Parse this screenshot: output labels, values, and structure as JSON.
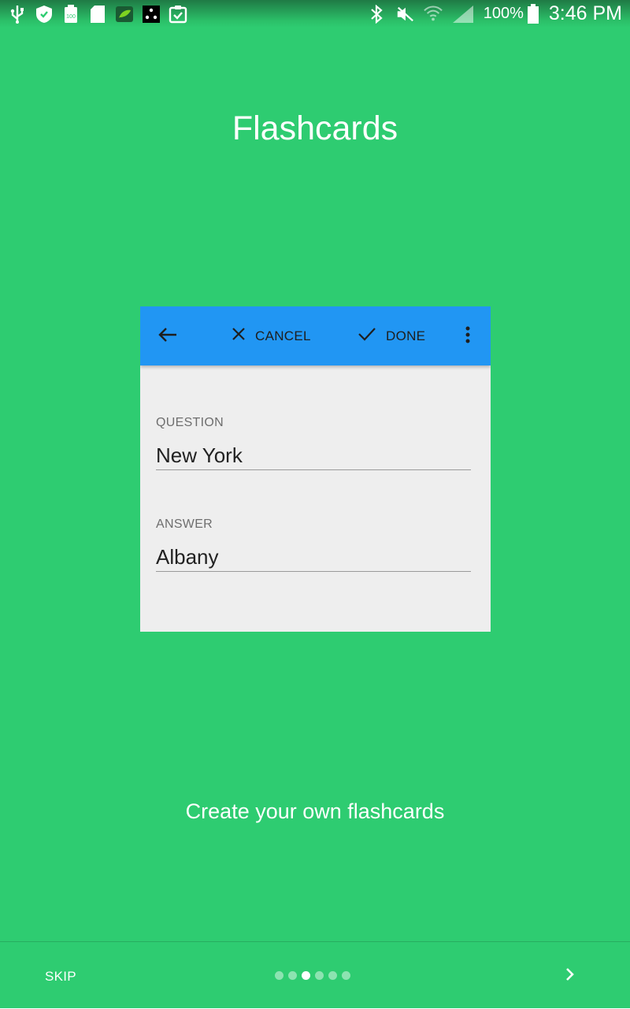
{
  "status_bar": {
    "left_icons": [
      "usb-icon",
      "shield-icon",
      "battery-100-icon",
      "sd-card-icon",
      "leaf-icon",
      "dice-icon",
      "clipboard-check-icon"
    ],
    "right_icons": [
      "bluetooth-icon",
      "vibrate-mute-icon",
      "wifi-icon",
      "signal-icon",
      "battery-icon"
    ],
    "battery_text": "100%",
    "time": "3:46 PM"
  },
  "page": {
    "title": "Flashcards",
    "subtitle": "Create your own flashcards",
    "background_color": "#2ecc71"
  },
  "card": {
    "toolbar": {
      "color": "#2196f3",
      "cancel_label": "CANCEL",
      "done_label": "DONE"
    },
    "fields": [
      {
        "label": "QUESTION",
        "value": "New York"
      },
      {
        "label": "ANSWER",
        "value": "Albany"
      }
    ]
  },
  "footer": {
    "skip_label": "SKIP",
    "page_count": 6,
    "current_page": 3
  }
}
